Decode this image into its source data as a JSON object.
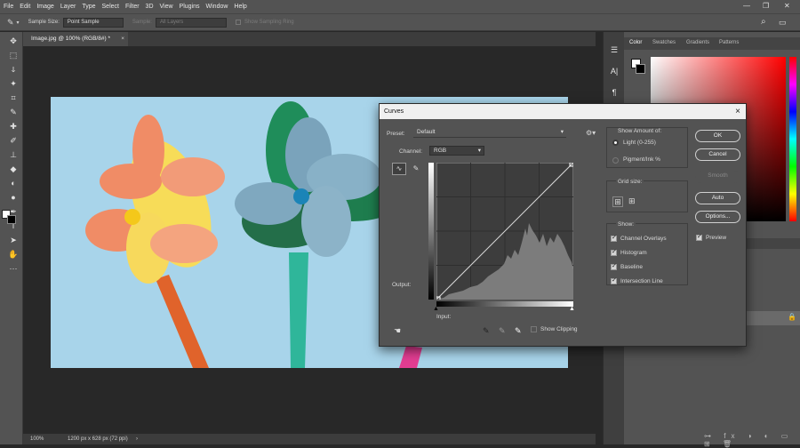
{
  "menubar": {
    "items": [
      "File",
      "Edit",
      "Image",
      "Layer",
      "Type",
      "Select",
      "Filter",
      "3D",
      "View",
      "Plugins",
      "Window",
      "Help"
    ]
  },
  "options": {
    "sample_size_label": "Sample Size:",
    "sample_size_value": "Point Sample",
    "sample_label": "Sample:",
    "sample_value": "All Layers",
    "show_sampling_ring": "Show Sampling Ring"
  },
  "document": {
    "tab_title": "Image.jpg @ 100% (RGB/8#) *",
    "zoom": "100%",
    "doc_info": "1200 px x 628 px (72 ppi)"
  },
  "color_panel": {
    "tabs": [
      "Color",
      "Swatches",
      "Gradients",
      "Patterns"
    ]
  },
  "curves": {
    "title": "Curves",
    "preset_label": "Preset:",
    "preset_value": "Default",
    "channel_label": "Channel:",
    "channel_value": "RGB",
    "output_label": "Output:",
    "input_label": "Input:",
    "show_clipping": "Show Clipping",
    "show_amount_label": "Show Amount of:",
    "light_option": "Light  (0-255)",
    "pigment_option": "Pigment/Ink %",
    "grid_size_label": "Grid size:",
    "show_label": "Show:",
    "show_options": [
      "Channel Overlays",
      "Histogram",
      "Baseline",
      "Intersection Line"
    ],
    "buttons": {
      "ok": "OK",
      "cancel": "Cancel",
      "smooth": "Smooth",
      "auto": "Auto",
      "options": "Options..."
    },
    "preview_label": "Preview"
  },
  "colors": {
    "app_bg": "#282828",
    "panel_bg": "#535353",
    "photo_bg": "#a9d5ea"
  }
}
